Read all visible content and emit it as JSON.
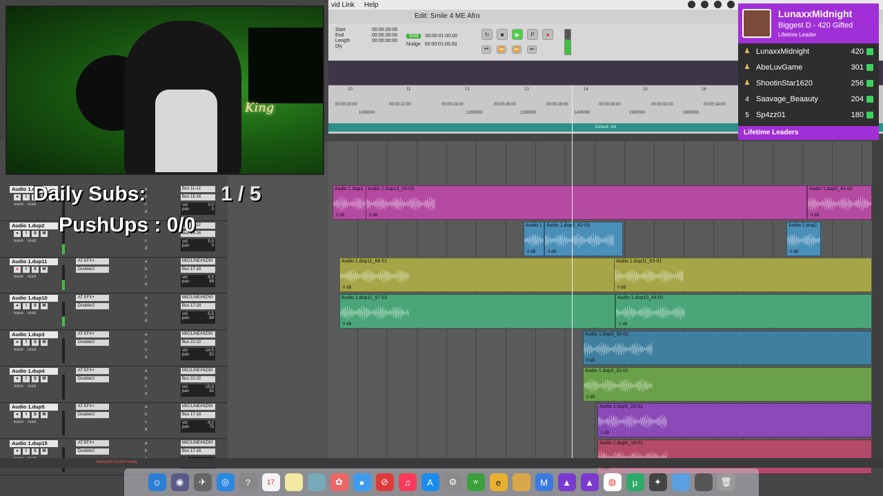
{
  "menubar": {
    "items": [
      "vid Link",
      "Help"
    ]
  },
  "window": {
    "title": "Edit: Smile 4 ME Afro"
  },
  "counter": {
    "start_label": "Start",
    "start_val": "00:00:28:06",
    "end_label": "End",
    "end_val": "00:00:28:06",
    "length_label": "Length",
    "length_val": "00:00:00:00",
    "dly_label": "Dly"
  },
  "grid": {
    "label": "Grid",
    "value": "00:00:01:00.00",
    "nudge_label": "Nudge",
    "nudge_value": "00:00:01:00.00"
  },
  "rulers": {
    "bars": [
      "10",
      "11",
      "12",
      "13",
      "14",
      "15",
      "16"
    ],
    "timecode": [
      "00:00:20:00",
      "00:00:22:00",
      "00:00:24:00",
      "00:00:26:00",
      "00:00:28:00",
      "00:00:30:00",
      "00:00:32:00",
      "00:00:34:00"
    ],
    "samples": [
      "1000000",
      "1200000",
      "1300000",
      "1400000",
      "1500000",
      "1600000"
    ],
    "meter_label": "Default: 4/4"
  },
  "tracks": [
    {
      "name": "Audio 1.dup13",
      "inserts": [],
      "input": "Bus 11-12",
      "output": "Bus 15-16",
      "vol": "0.0",
      "pan": "0",
      "rec": false
    },
    {
      "name": "Audio 1.dup2",
      "inserts": [],
      "input": "Bus 11-12",
      "output": "Bus 15-16",
      "vol": "0.0",
      "pan": "0",
      "rec": false
    },
    {
      "name": "Audio 1.dup11",
      "inserts": [
        "AT EFX+",
        "Doubler2"
      ],
      "input": "MIC/LINE/HIZ/M",
      "output": "Bus 17-18",
      "vol": "-5.9",
      "pan": "69",
      "rec": true
    },
    {
      "name": "Audio 1.dup10",
      "inserts": [
        "AT EFX+",
        "Doubler2"
      ],
      "input": "MIC/LINE/HIZ/M",
      "output": "Bus 17-18",
      "vol": "-5.5",
      "pan": "89",
      "rec": false
    },
    {
      "name": "Audio 1.dup3",
      "inserts": [
        "AT EFX+",
        "Doubler2"
      ],
      "input": "MIC/LINE/HIZ/M",
      "output": "Bus 21-22",
      "vol": "-14.5",
      "pan": "52",
      "rec": false
    },
    {
      "name": "Audio 1.dup4",
      "inserts": [
        "AT EFX+",
        "Doubler2"
      ],
      "input": "MIC/LINE/HIZ/M",
      "output": "Bus 21-22",
      "vol": "-15.8",
      "pan": "52",
      "rec": false
    },
    {
      "name": "Audio 1.dup5",
      "inserts": [
        "AT EFX+",
        "Doubler2"
      ],
      "input": "MIC/LINE/HIZ/M",
      "output": "Bus 17-18",
      "vol": "-9.2",
      "pan": "75",
      "rec": false
    },
    {
      "name": "Audio 1.dup15",
      "inserts": [
        "AT EFX+",
        "Doubler2"
      ],
      "input": "MIC/LINE/HIZ/M",
      "output": "Bus 17-18",
      "vol": "",
      "pan": "",
      "rec": false
    }
  ],
  "track_labels": {
    "wave": "wave",
    "read": "read",
    "vol": "vol",
    "pan": "pan",
    "sends": [
      "a",
      "b",
      "c",
      "d"
    ]
  },
  "clips": [
    {
      "name": "Audio 1.dup1",
      "db": "0 dB",
      "color": "#b44aa2"
    },
    {
      "name": "Audio 1.dup13_33-03",
      "db": "0 dB",
      "color": "#b44aa2"
    },
    {
      "name": "Audio 1.dup2_41-02",
      "db": "0 dB",
      "color": "#b44aa2"
    },
    {
      "name": "Audio 1",
      "db": "0 dB",
      "color": "#4a8fb8"
    },
    {
      "name": "Audio 1.dup2_41-03",
      "db": "0 dB",
      "color": "#4a8fb8"
    },
    {
      "name": "Audio 1.dup2",
      "db": "0 dB",
      "color": "#4a8fb8"
    },
    {
      "name": "Audio 1.dup11_68-01",
      "db": "0 dB",
      "color": "#a6a648"
    },
    {
      "name": "Audio 1.dup11_63-01",
      "db": "0 dB",
      "color": "#a6a648"
    },
    {
      "name": "Audio 1.dup11_67-01",
      "db": "0 dB",
      "color": "#4aa678"
    },
    {
      "name": "Audio 1.dup10_44-01",
      "db": "0 dB",
      "color": "#4aa678"
    },
    {
      "name": "Audio 1.dup3_33-01",
      "db": "0 dB",
      "color": "#3f7fa0"
    },
    {
      "name": "Audio 1.dup3_32-01",
      "db": "0 dB",
      "color": "#6aa04a"
    },
    {
      "name": "Audio 1.dup5_20-01",
      "db": "0 dB",
      "color": "#8a4ab8"
    },
    {
      "name": "Audio 1.dup5_18-01",
      "db": "0 dB",
      "color": "#b44a6a"
    }
  ],
  "status": {
    "transport": "transport record ready"
  },
  "overlay": {
    "subs_label": "Daily Subs:",
    "subs_value": "1 / 5",
    "push_label": "PushUps : 0/0"
  },
  "webcam": {
    "neon_text": "King"
  },
  "leaderboard": {
    "top_name": "LunaxxMidnight",
    "top_sub": "Biggest D - 420 Gifted",
    "top_tag": "Lifetime Leader",
    "rows": [
      {
        "rank": "1",
        "name": "LunaxxMidnight",
        "score": "420"
      },
      {
        "rank": "2",
        "name": "AbeLuvGame",
        "score": "301"
      },
      {
        "rank": "3",
        "name": "ShootinStar1620",
        "score": "256"
      },
      {
        "rank": "4",
        "name": "Saavage_Beaauty",
        "score": "204"
      },
      {
        "rank": "5",
        "name": "Sp4zz01",
        "score": "180"
      }
    ],
    "footer": "Lifetime Leaders"
  },
  "dock": {
    "calendar_day": "17"
  },
  "colors": {
    "accent_purple": "#a12fd6",
    "play_green": "#48d148",
    "gift_green": "#39d35a"
  }
}
